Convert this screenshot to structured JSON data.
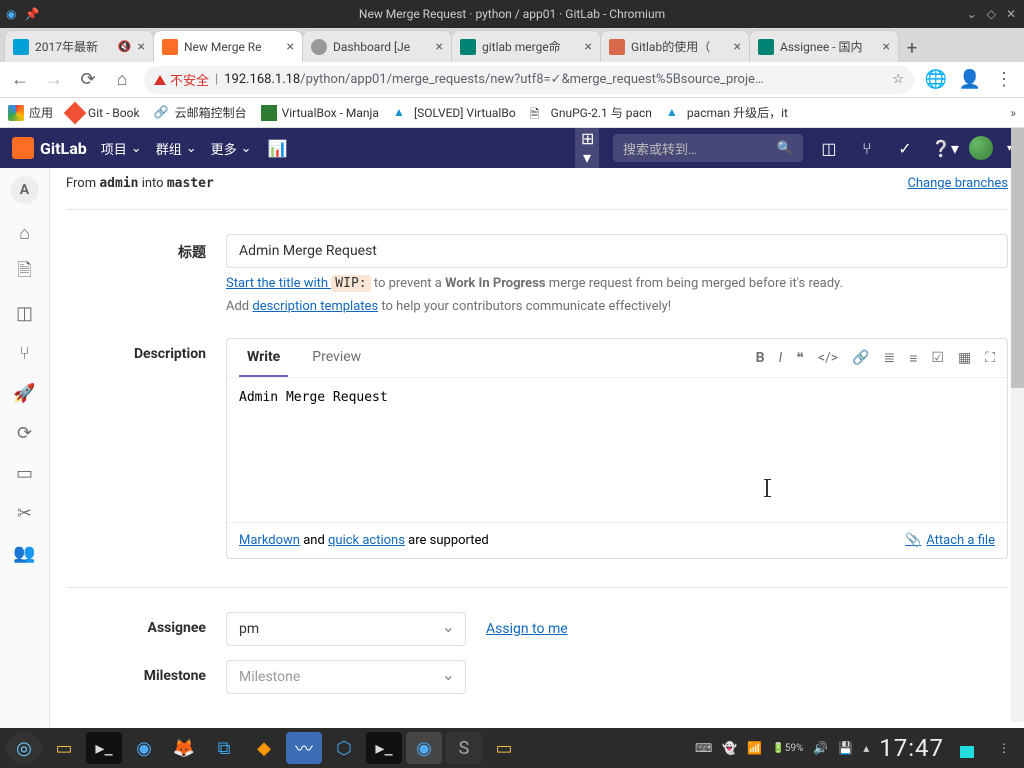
{
  "window": {
    "title": "New Merge Request · python / app01 · GitLab - Chromium"
  },
  "browser_tabs": [
    {
      "label": "2017年最新",
      "fav_color": "#00a1d6",
      "muted": true
    },
    {
      "label": "New Merge Re",
      "fav_color": "#fc6d26",
      "active": true
    },
    {
      "label": "Dashboard [Je",
      "fav_color": "#999"
    },
    {
      "label": "gitlab merge命",
      "fav_color": "#008373"
    },
    {
      "label": "Gitlab的使用（",
      "fav_color": "#d96b4a"
    },
    {
      "label": "Assignee - 国内",
      "fav_color": "#008373"
    }
  ],
  "address_bar": {
    "insecure_label": "不安全",
    "host": "192.168.1.18",
    "path": "/python/app01/merge_requests/new?utf8=✓&merge_request%5Bsource_proje…"
  },
  "bookmarks": [
    {
      "label": "应用",
      "color": "#888"
    },
    {
      "label": "Git - Book",
      "color": "#f05033"
    },
    {
      "label": "云邮箱控制台",
      "color": "#333"
    },
    {
      "label": "VirtualBox - Manja",
      "color": "#2f7d32"
    },
    {
      "label": "[SOLVED] VirtualBo",
      "color": "#1793d1"
    },
    {
      "label": "GnuPG-2.1 与 pacn",
      "color": "#333"
    },
    {
      "label": "pacman 升级后，it",
      "color": "#1793d1"
    }
  ],
  "gitlab_header": {
    "brand": "GitLab",
    "menus": [
      "项目",
      "群组",
      "更多"
    ],
    "search_placeholder": "搜索或转到…"
  },
  "branch_info": {
    "prefix": "From ",
    "source": "admin",
    "mid": " into ",
    "target": "master",
    "change_link": "Change branches"
  },
  "form": {
    "title_label": "标题",
    "title_value": "Admin Merge Request",
    "wip_hint_prefix": "Start the title with ",
    "wip_code": "WIP:",
    "wip_hint_mid": " to prevent a ",
    "wip_bold": "Work In Progress",
    "wip_hint_suffix": " merge request from being merged before it's ready.",
    "template_hint_prefix": "Add ",
    "template_link": "description templates",
    "template_hint_suffix": " to help your contributors communicate effectively!",
    "desc_label": "Description",
    "desc_tabs": {
      "write": "Write",
      "preview": "Preview"
    },
    "desc_value": "Admin Merge Request",
    "desc_foot_markdown": "Markdown",
    "desc_foot_mid": " and ",
    "desc_foot_quick": "quick actions",
    "desc_foot_suffix": " are supported",
    "attach_label": "Attach a file",
    "assignee_label": "Assignee",
    "assignee_value": "pm",
    "assign_me": "Assign to me",
    "milestone_label": "Milestone",
    "milestone_placeholder": "Milestone"
  },
  "sidebar_project_letter": "A",
  "taskbar": {
    "clock": "17:47",
    "battery": "59%"
  }
}
